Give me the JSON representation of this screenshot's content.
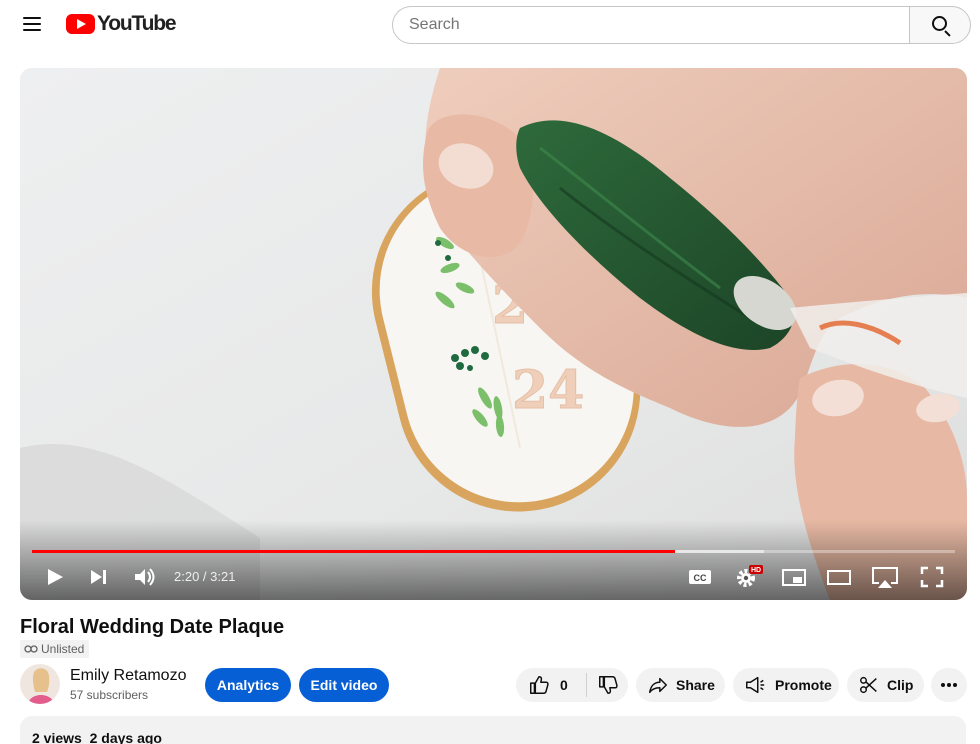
{
  "header": {
    "logo_text": "YouTube",
    "search_placeholder": "Search"
  },
  "player": {
    "current_time": "2:20",
    "duration": "3:21",
    "time_display": "2:20 / 3:21",
    "progress_played_fraction": 0.697,
    "progress_buffered_fraction": 0.793,
    "hd_badge": "HD",
    "cc_label": "CC",
    "video_overlay_text": [
      "28",
      "24"
    ]
  },
  "video": {
    "title": "Floral Wedding Date Plaque",
    "visibility": "Unlisted",
    "views_date": "2 views  2 days ago"
  },
  "channel": {
    "name": "Emily Retamozo",
    "subscribers": "57 subscribers"
  },
  "actions": {
    "analytics": "Analytics",
    "edit_video": "Edit video",
    "like_count": "0",
    "share": "Share",
    "promote": "Promote",
    "clip": "Clip"
  },
  "colors": {
    "brand_red": "#ff0000",
    "primary_blue": "#065fd4",
    "pill_grey": "#f2f2f2"
  }
}
